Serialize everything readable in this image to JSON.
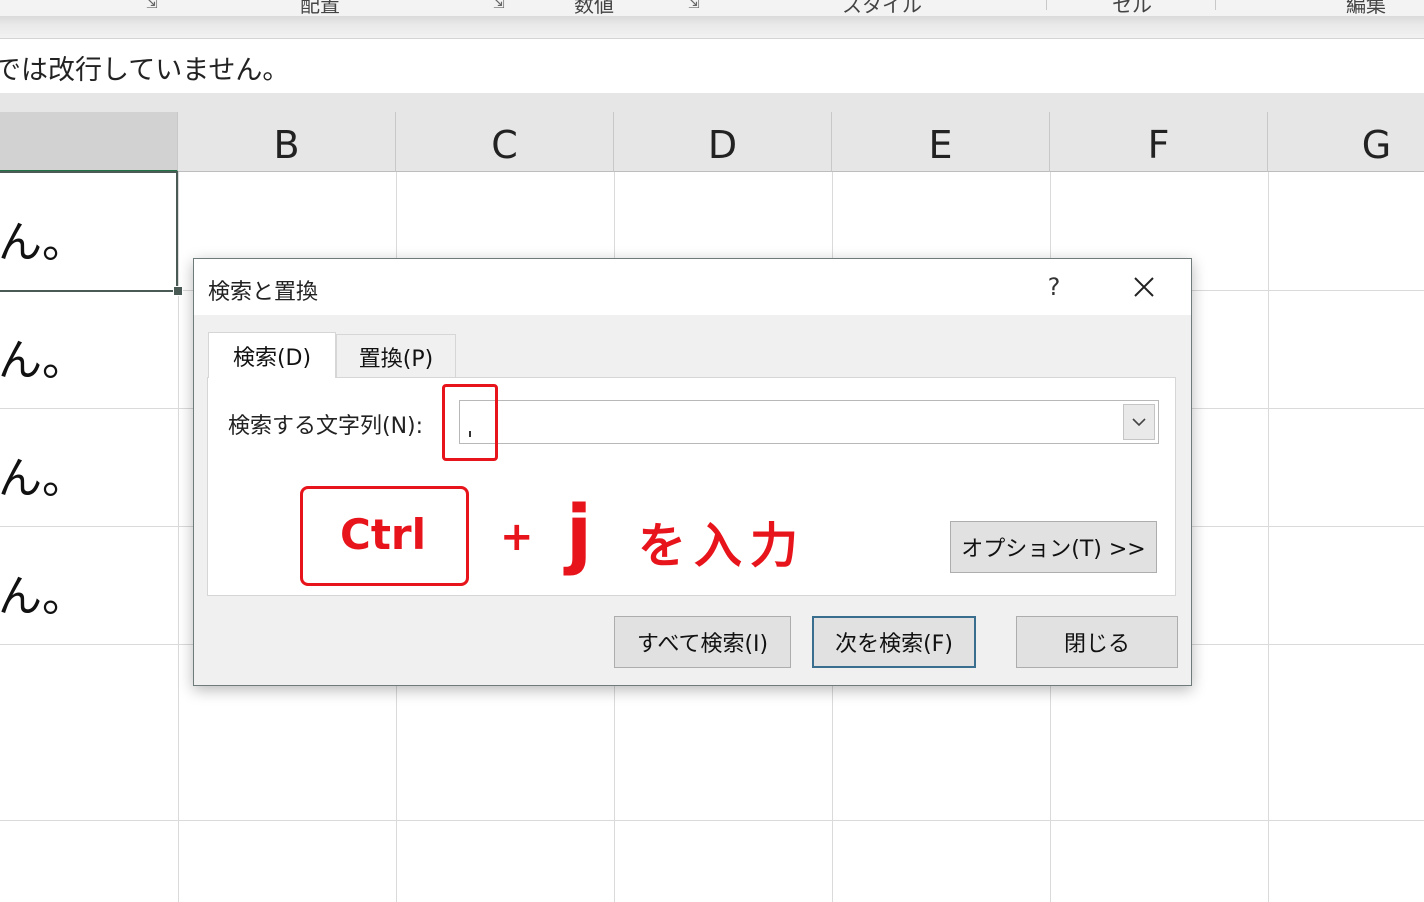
{
  "ribbon": {
    "groups": [
      "配置",
      "数値",
      "スタイル",
      "セル",
      "編集"
    ]
  },
  "formula_bar": {
    "text": "では改行していません。"
  },
  "columns": [
    "B",
    "C",
    "D",
    "E",
    "F",
    "G"
  ],
  "cells": {
    "a_fragments": [
      "ん。",
      "ん。",
      "ん。",
      "ん。"
    ]
  },
  "dialog": {
    "title": "検索と置換",
    "help": "?",
    "tabs": [
      {
        "label": "検索(D)",
        "active": true
      },
      {
        "label": "置換(P)",
        "active": false
      }
    ],
    "find_label": "検索する文字列(N):",
    "find_value": "",
    "options_button": "オプション(T) >>",
    "find_all_button": "すべて検索(I)",
    "find_next_button": "次を検索(F)",
    "close_button": "閉じる"
  },
  "annotation": {
    "key": "Ctrl",
    "plus": "+",
    "letter": "j",
    "suffix": "を入力",
    "color": "#e8141c"
  },
  "colors": {
    "excel_green": "#217346",
    "annotation_red": "#e8141c"
  }
}
